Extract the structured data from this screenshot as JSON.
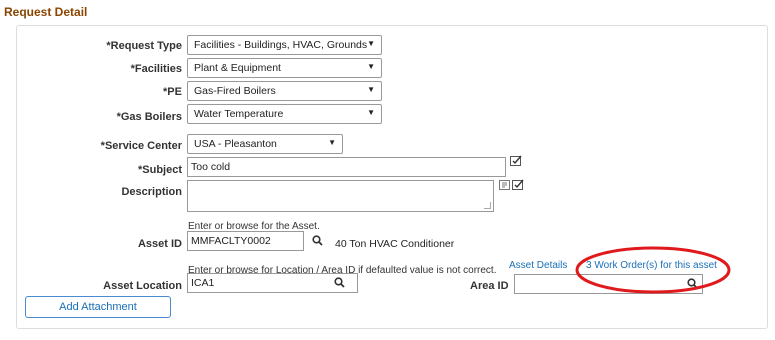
{
  "section": {
    "title": "Request Detail"
  },
  "fields": {
    "request_type": {
      "label": "*Request Type",
      "value": "Facilities - Buildings, HVAC, Grounds"
    },
    "facilities": {
      "label": "*Facilities",
      "value": "Plant & Equipment"
    },
    "pe": {
      "label": "*PE",
      "value": "Gas-Fired Boilers"
    },
    "gas_boilers": {
      "label": "*Gas Boilers",
      "value": "Water Temperature"
    },
    "service_center": {
      "label": "*Service Center",
      "value": "USA - Pleasanton"
    },
    "subject": {
      "label": "*Subject",
      "value": "Too cold"
    },
    "description": {
      "label": "Description",
      "value": ""
    },
    "asset_id": {
      "label": "Asset ID",
      "hint": "Enter or browse for the Asset.",
      "value": "MMFACLTY0002",
      "description": "40 Ton HVAC Conditioner"
    },
    "asset_location": {
      "label": "Asset Location",
      "hint": "Enter or browse for Location / Area ID if defaulted value is not correct.",
      "value": "ICA1"
    },
    "area_id": {
      "label": "Area ID",
      "value": ""
    }
  },
  "links": {
    "asset_details": "Asset Details",
    "work_orders": "3 Work Order(s) for this asset"
  },
  "buttons": {
    "add_attachment": "Add Attachment"
  },
  "annotation": {
    "color": "#e0191c"
  }
}
